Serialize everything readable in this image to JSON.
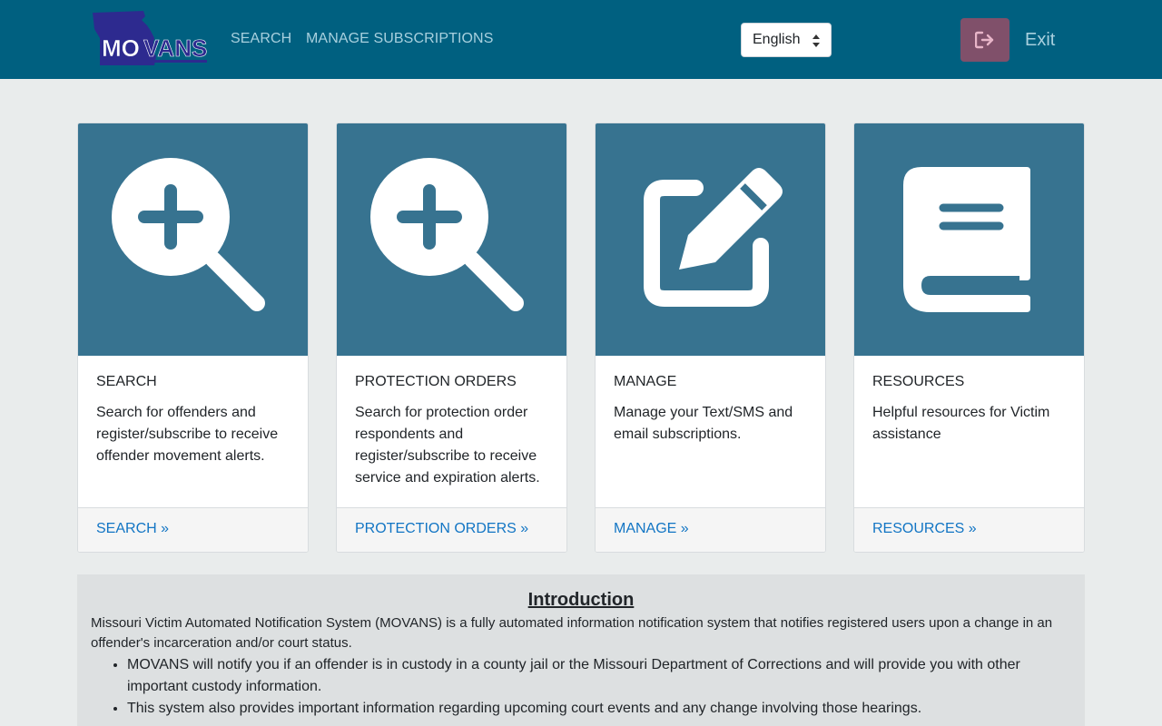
{
  "header": {
    "logo_text": "MOVANS",
    "nav": [
      {
        "label": "SEARCH"
      },
      {
        "label": "MANAGE SUBSCRIPTIONS"
      }
    ],
    "language": {
      "selected": "English"
    },
    "exit_label": "Exit"
  },
  "colors": {
    "header_bg": "#006080",
    "card_image_bg": "#377390",
    "link": "#1275c4",
    "exit_button": "#80506a"
  },
  "cards": [
    {
      "icon": "search-plus-icon",
      "title": "SEARCH",
      "text": "Search for offenders and register/subscribe to receive offender movement alerts.",
      "link": "SEARCH »"
    },
    {
      "icon": "search-plus-icon",
      "title": "PROTECTION ORDERS",
      "text": "Search for protection order respondents and register/subscribe to receive service and expiration alerts.",
      "link": "PROTECTION ORDERS »"
    },
    {
      "icon": "edit-icon",
      "title": "MANAGE",
      "text": "Manage your Text/SMS and email subscriptions.",
      "link": "MANAGE »"
    },
    {
      "icon": "book-icon",
      "title": "RESOURCES",
      "text": "Helpful resources for Victim assistance",
      "link": "RESOURCES »"
    }
  ],
  "intro": {
    "heading": "Introduction",
    "paragraph": "Missouri Victim Automated Notification System (MOVANS) is a fully automated information notification system that notifies registered users upon a change in an offender's incarceration and/or court status.",
    "bullets": [
      "MOVANS will notify you if an offender is in custody in a county jail or the Missouri Department of Corrections and will provide you with other important custody information.",
      "This system also provides important information regarding upcoming court events and any change involving those hearings."
    ]
  }
}
